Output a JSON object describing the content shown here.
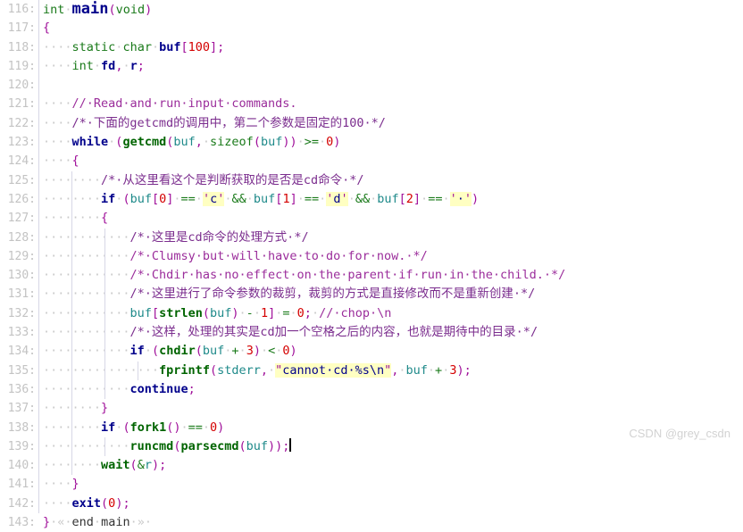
{
  "editor": {
    "language": "C",
    "first_line": 116,
    "last_line": 143,
    "cursor_line": 139,
    "colors": {
      "background": "#ffffff",
      "gutter_text": "#c3c3c3",
      "keyword": "#1a7a1a",
      "declaration": "#00008b",
      "function": "#006400",
      "variable": "#1f8a8a",
      "number": "#d40000",
      "punctuation": "#a0109a",
      "comment": "#9b2d9b",
      "literal_highlight": "#ffffc2",
      "whitespace_dot": "#c9c9c9",
      "indent_guide": "#d7d7e6"
    }
  },
  "lines": [
    {
      "n": "116:",
      "guides": [],
      "text": "int main(void)"
    },
    {
      "n": "117:",
      "guides": [],
      "text": "{"
    },
    {
      "n": "118:",
      "guides": [
        0
      ],
      "text": "    static char buf[100];"
    },
    {
      "n": "119:",
      "guides": [
        0
      ],
      "text": "    int fd, r;"
    },
    {
      "n": "120:",
      "guides": [],
      "text": ""
    },
    {
      "n": "121:",
      "guides": [
        0
      ],
      "text": "    // Read and run input commands."
    },
    {
      "n": "122:",
      "guides": [
        0
      ],
      "text": "    /* 下面的getcmd的调用中，第二个参数是固定的100 */"
    },
    {
      "n": "123:",
      "guides": [
        0
      ],
      "text": "    while (getcmd(buf, sizeof(buf)) >= 0)"
    },
    {
      "n": "124:",
      "guides": [
        0
      ],
      "text": "    {"
    },
    {
      "n": "125:",
      "guides": [
        0,
        1
      ],
      "text": "        /* 从这里看这个是判断获取的是否是cd命令 */"
    },
    {
      "n": "126:",
      "guides": [
        0,
        1
      ],
      "text": "        if (buf[0] == 'c' && buf[1] == 'd' && buf[2] == ' ')"
    },
    {
      "n": "127:",
      "guides": [
        0,
        1
      ],
      "text": "        {"
    },
    {
      "n": "128:",
      "guides": [
        0,
        1,
        2
      ],
      "text": "            /* 这里是cd命令的处理方式 */"
    },
    {
      "n": "129:",
      "guides": [
        0,
        1,
        2
      ],
      "text": "            /* Clumsy but will have to do for now. */"
    },
    {
      "n": "130:",
      "guides": [
        0,
        1,
        2
      ],
      "text": "            /* Chdir has no effect on the parent if run in the child. */"
    },
    {
      "n": "131:",
      "guides": [
        0,
        1,
        2
      ],
      "text": "            /* 这里进行了命令参数的裁剪，裁剪的方式是直接修改而不是重新创建 */"
    },
    {
      "n": "132:",
      "guides": [
        0,
        1,
        2
      ],
      "text": "            buf[strlen(buf) - 1] = 0; // chop \\n"
    },
    {
      "n": "133:",
      "guides": [
        0,
        1,
        2
      ],
      "text": "            /* 这样，处理的其实是cd加一个空格之后的内容，也就是期待中的目录 */"
    },
    {
      "n": "134:",
      "guides": [
        0,
        1,
        2
      ],
      "text": "            if (chdir(buf + 3) < 0)"
    },
    {
      "n": "135:",
      "guides": [
        0,
        1,
        2,
        3
      ],
      "text": "                fprintf(stderr, \"cannot cd %s\\n\", buf + 3);"
    },
    {
      "n": "136:",
      "guides": [
        0,
        1,
        2
      ],
      "text": "            continue;"
    },
    {
      "n": "137:",
      "guides": [
        0,
        1
      ],
      "text": "        }"
    },
    {
      "n": "138:",
      "guides": [
        0,
        1
      ],
      "text": "        if (fork1() == 0)"
    },
    {
      "n": "139:",
      "guides": [
        0,
        1,
        2
      ],
      "text": "            runcmd(parsecmd(buf));"
    },
    {
      "n": "140:",
      "guides": [
        0,
        1
      ],
      "text": "        wait(&r);"
    },
    {
      "n": "141:",
      "guides": [
        0
      ],
      "text": "    }"
    },
    {
      "n": "142:",
      "guides": [
        0
      ],
      "text": "    exit(0);"
    },
    {
      "n": "143:",
      "guides": [],
      "text": "} « end main »"
    }
  ],
  "watermark": {
    "text": "CSDN @grey_csdn"
  }
}
